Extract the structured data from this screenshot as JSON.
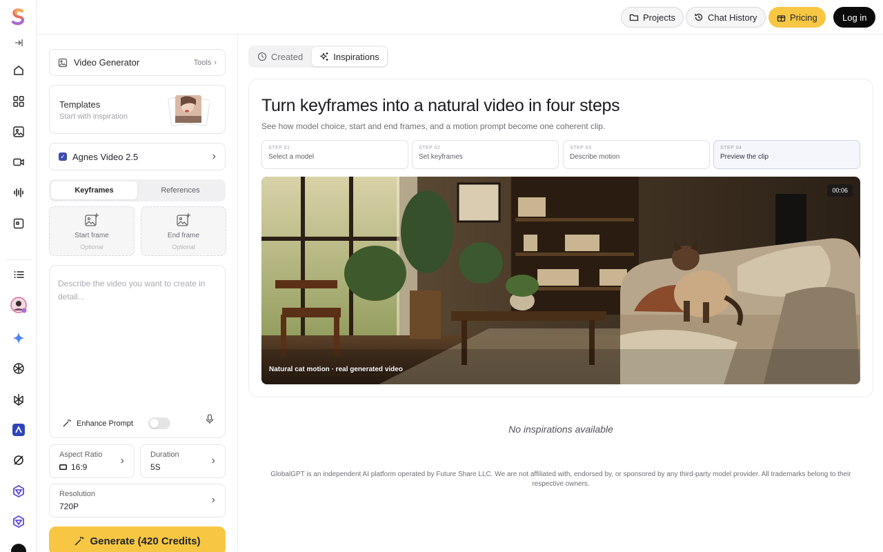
{
  "topbar": {
    "projects": "Projects",
    "chat_history": "Chat History",
    "pricing": "Pricing",
    "login": "Log in"
  },
  "rail": {
    "icons": [
      "collapse-icon",
      "home-icon",
      "apps-grid-icon",
      "image-icon",
      "video-icon",
      "audio-wave-icon",
      "slides-icon",
      "list-icon",
      "avatar",
      "sparkle-icon",
      "openai-icon",
      "perplexity-icon",
      "agnes-icon",
      "grok-icon",
      "nano-icon",
      "nano-icon-2"
    ]
  },
  "panel": {
    "tool_title": "Video Generator",
    "tools_label": "Tools",
    "templates_title": "Templates",
    "templates_sub": "Start with inspiration",
    "model": "Agnes Video 2.5",
    "tabs": [
      "Keyframes",
      "References"
    ],
    "start_frame": "Start frame",
    "end_frame": "End frame",
    "optional": "Optional",
    "prompt_placeholder": "Describe the video you want to create in detail...",
    "enhance": "Enhance Prompt",
    "aspect_label": "Aspect Ratio",
    "aspect_value": "16:9",
    "duration_label": "Duration",
    "duration_value": "5S",
    "resolution_label": "Resolution",
    "resolution_value": "720P",
    "generate": "Generate (420 Credits)"
  },
  "main": {
    "tabs": [
      "Created",
      "Inspirations"
    ],
    "hero_title": "Turn keyframes into a natural video in four steps",
    "hero_sub": "See how model choice, start and end frames, and a motion prompt become one coherent clip.",
    "steps": [
      {
        "num": "STEP 01",
        "label": "Select a model"
      },
      {
        "num": "STEP 02",
        "label": "Set keyframes"
      },
      {
        "num": "STEP 03",
        "label": "Describe motion"
      },
      {
        "num": "STEP 04",
        "label": "Preview the clip"
      }
    ],
    "video_time": "00:06",
    "video_caption": "Natural cat motion · real generated video",
    "empty": "No inspirations available",
    "footer": "GlobalGPT is an independent AI platform operated by Future Share LLC. We are not affiliated with, endorsed by, or sponsored by any third-party model provider. All trademarks belong to their respective owners."
  },
  "colors": {
    "accent": "#f7c744",
    "dark": "#0b0b0c"
  }
}
